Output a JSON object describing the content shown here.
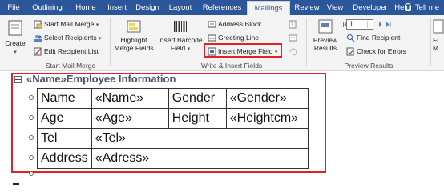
{
  "tabs": [
    "File",
    "Outlining",
    "Home",
    "Insert",
    "Design",
    "Layout",
    "References",
    "Mailings",
    "Review",
    "View",
    "Developer",
    "Help"
  ],
  "active_tab": "Mailings",
  "tell_me": "Tell me",
  "ribbon": {
    "create": {
      "label": "Create"
    },
    "start_mail_merge": {
      "start_label": "Start Mail Merge",
      "select_recipients_label": "Select Recipients",
      "edit_list_label": "Edit Recipient List",
      "group_label": "Start Mail Merge"
    },
    "write_insert": {
      "highlight_line1": "Highlight",
      "highlight_line2": "Merge Fields",
      "barcode_line1": "Insert Barcode",
      "barcode_line2": "Field",
      "address_block_label": "Address Block",
      "greeting_line_label": "Greeting Line",
      "insert_merge_field_label": "Insert Merge Field",
      "group_label": "Write & Insert Fields"
    },
    "preview": {
      "preview_line1": "Preview",
      "preview_line2": "Results",
      "record_value": "1",
      "find_recipient_label": "Find Recipient",
      "check_errors_label": "Check for Errors",
      "group_label": "Preview Results"
    },
    "finish": {
      "line1": "Fi",
      "line2": "M"
    }
  },
  "document": {
    "title": "«Name»Employee Information",
    "table": [
      [
        "Name",
        "«Name»",
        "Gender",
        "«Gender»"
      ],
      [
        "Age",
        "«Age»",
        "Height",
        "«Heightcm»"
      ],
      [
        "Tel",
        "«Tel»"
      ],
      [
        "Address",
        "«Adress»"
      ]
    ]
  },
  "colors": {
    "tabbar": "#2b579a",
    "highlight": "#e0212b",
    "title": "#44546a"
  }
}
